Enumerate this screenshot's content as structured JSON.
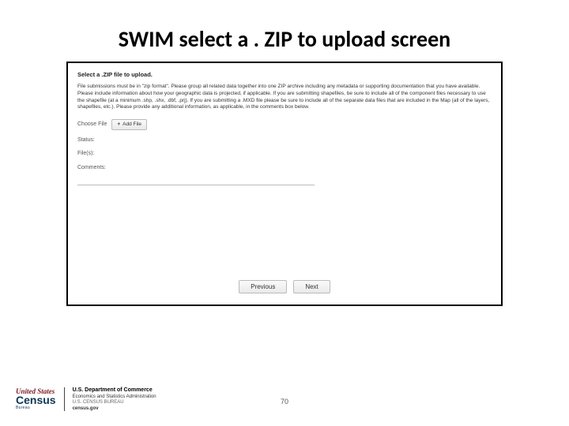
{
  "title": "SWIM select a . ZIP to upload screen",
  "panel": {
    "header": "Select a .ZIP file to upload.",
    "instructions": "File submissions must be in \"zip format\". Please group all related data together into one ZIP archive including any metadata or supporting documentation that you have available. Please include information about how your geographic data is projected, if applicable. If you are submitting shapefiles, be sure to include all of the component files necessary to use the shapefile (at a minimum .shp, .shx, .dbf, .prj). If you are submitting a .MXD file please be sure to include all of the separate data files that are included in the Map (all of the layers, shapefiles, etc.). Please provide any additional information, as applicable, in the comments box below.",
    "choose_label": "Choose File",
    "add_file": "Add File",
    "status_label": "Status:",
    "files_label": "File(s):",
    "comments_label": "Comments:",
    "prev": "Previous",
    "next": "Next"
  },
  "footer": {
    "logo_us": "United States",
    "logo_census": "Census",
    "logo_bureau": "Bureau",
    "dept1": "U.S. Department of Commerce",
    "dept2": "Economics and Statistics Administration",
    "dept3": "U.S. CENSUS BUREAU",
    "dept4": "census.gov"
  },
  "page_number": "70"
}
